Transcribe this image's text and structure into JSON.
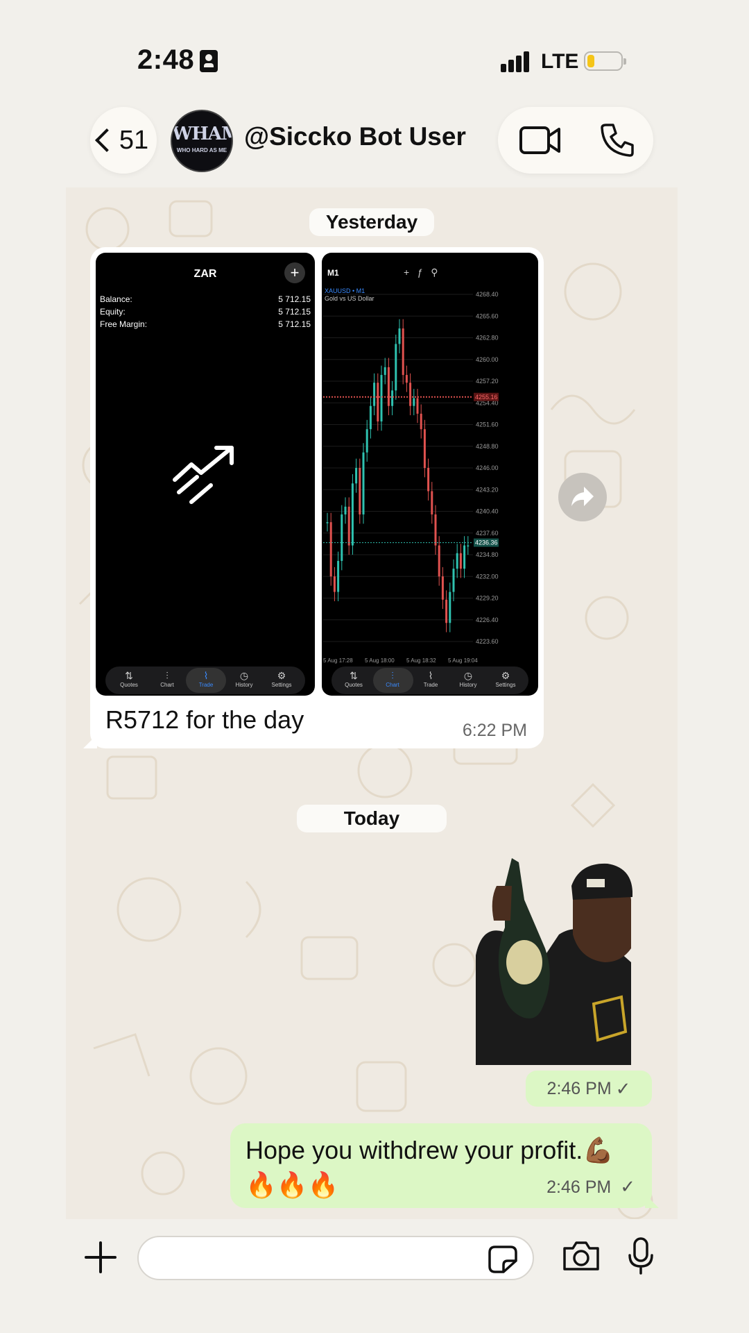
{
  "status_bar": {
    "time": "2:48",
    "network": "LTE"
  },
  "header": {
    "back_count": "51",
    "contact_name": "@Siccko Bot User",
    "avatar_text": "WHAM",
    "avatar_subtext": "WHO HARD AS ME"
  },
  "dates": {
    "yesterday": "Yesterday",
    "today": "Today"
  },
  "incoming": {
    "caption": "R5712 for the day",
    "time": "6:22 PM",
    "left_screenshot": {
      "title": "ZAR",
      "rows": [
        {
          "label": "Balance:",
          "value": "5 712.15"
        },
        {
          "label": "Equity:",
          "value": "5 712.15"
        },
        {
          "label": "Free Margin:",
          "value": "5 712.15"
        }
      ],
      "nav": [
        "Quotes",
        "Chart",
        "Trade",
        "History",
        "Settings"
      ],
      "active_nav": "Trade"
    },
    "right_screenshot": {
      "timeframe": "M1",
      "symbol": "XAUUSD • M1",
      "description": "Gold vs US Dollar",
      "price_labels": [
        "4268.40",
        "4265.60",
        "4262.80",
        "4260.00",
        "4257.20",
        "4254.40",
        "4251.60",
        "4248.80",
        "4246.00",
        "4243.20",
        "4240.40",
        "4237.60",
        "4234.80",
        "4232.00",
        "4229.20",
        "4226.40",
        "4223.60"
      ],
      "highlight_price": "4255.16",
      "current_price": "4236.36",
      "time_labels": [
        "5 Aug 17:28",
        "5 Aug 18:00",
        "5 Aug 18:32",
        "5 Aug 19:04"
      ],
      "nav": [
        "Quotes",
        "Chart",
        "Trade",
        "History",
        "Settings"
      ],
      "active_nav": "Chart"
    }
  },
  "outgoing": {
    "sticker_time": "2:46 PM",
    "message_text": "Hope you withdrew your profit.💪🏾🔥🔥🔥",
    "message_time": "2:46 PM",
    "check": "✓"
  },
  "composer": {
    "placeholder": ""
  },
  "colors": {
    "outgoing_bubble": "#dcf7c5",
    "incoming_bubble": "#ffffff",
    "background": "#f2f0eb"
  }
}
